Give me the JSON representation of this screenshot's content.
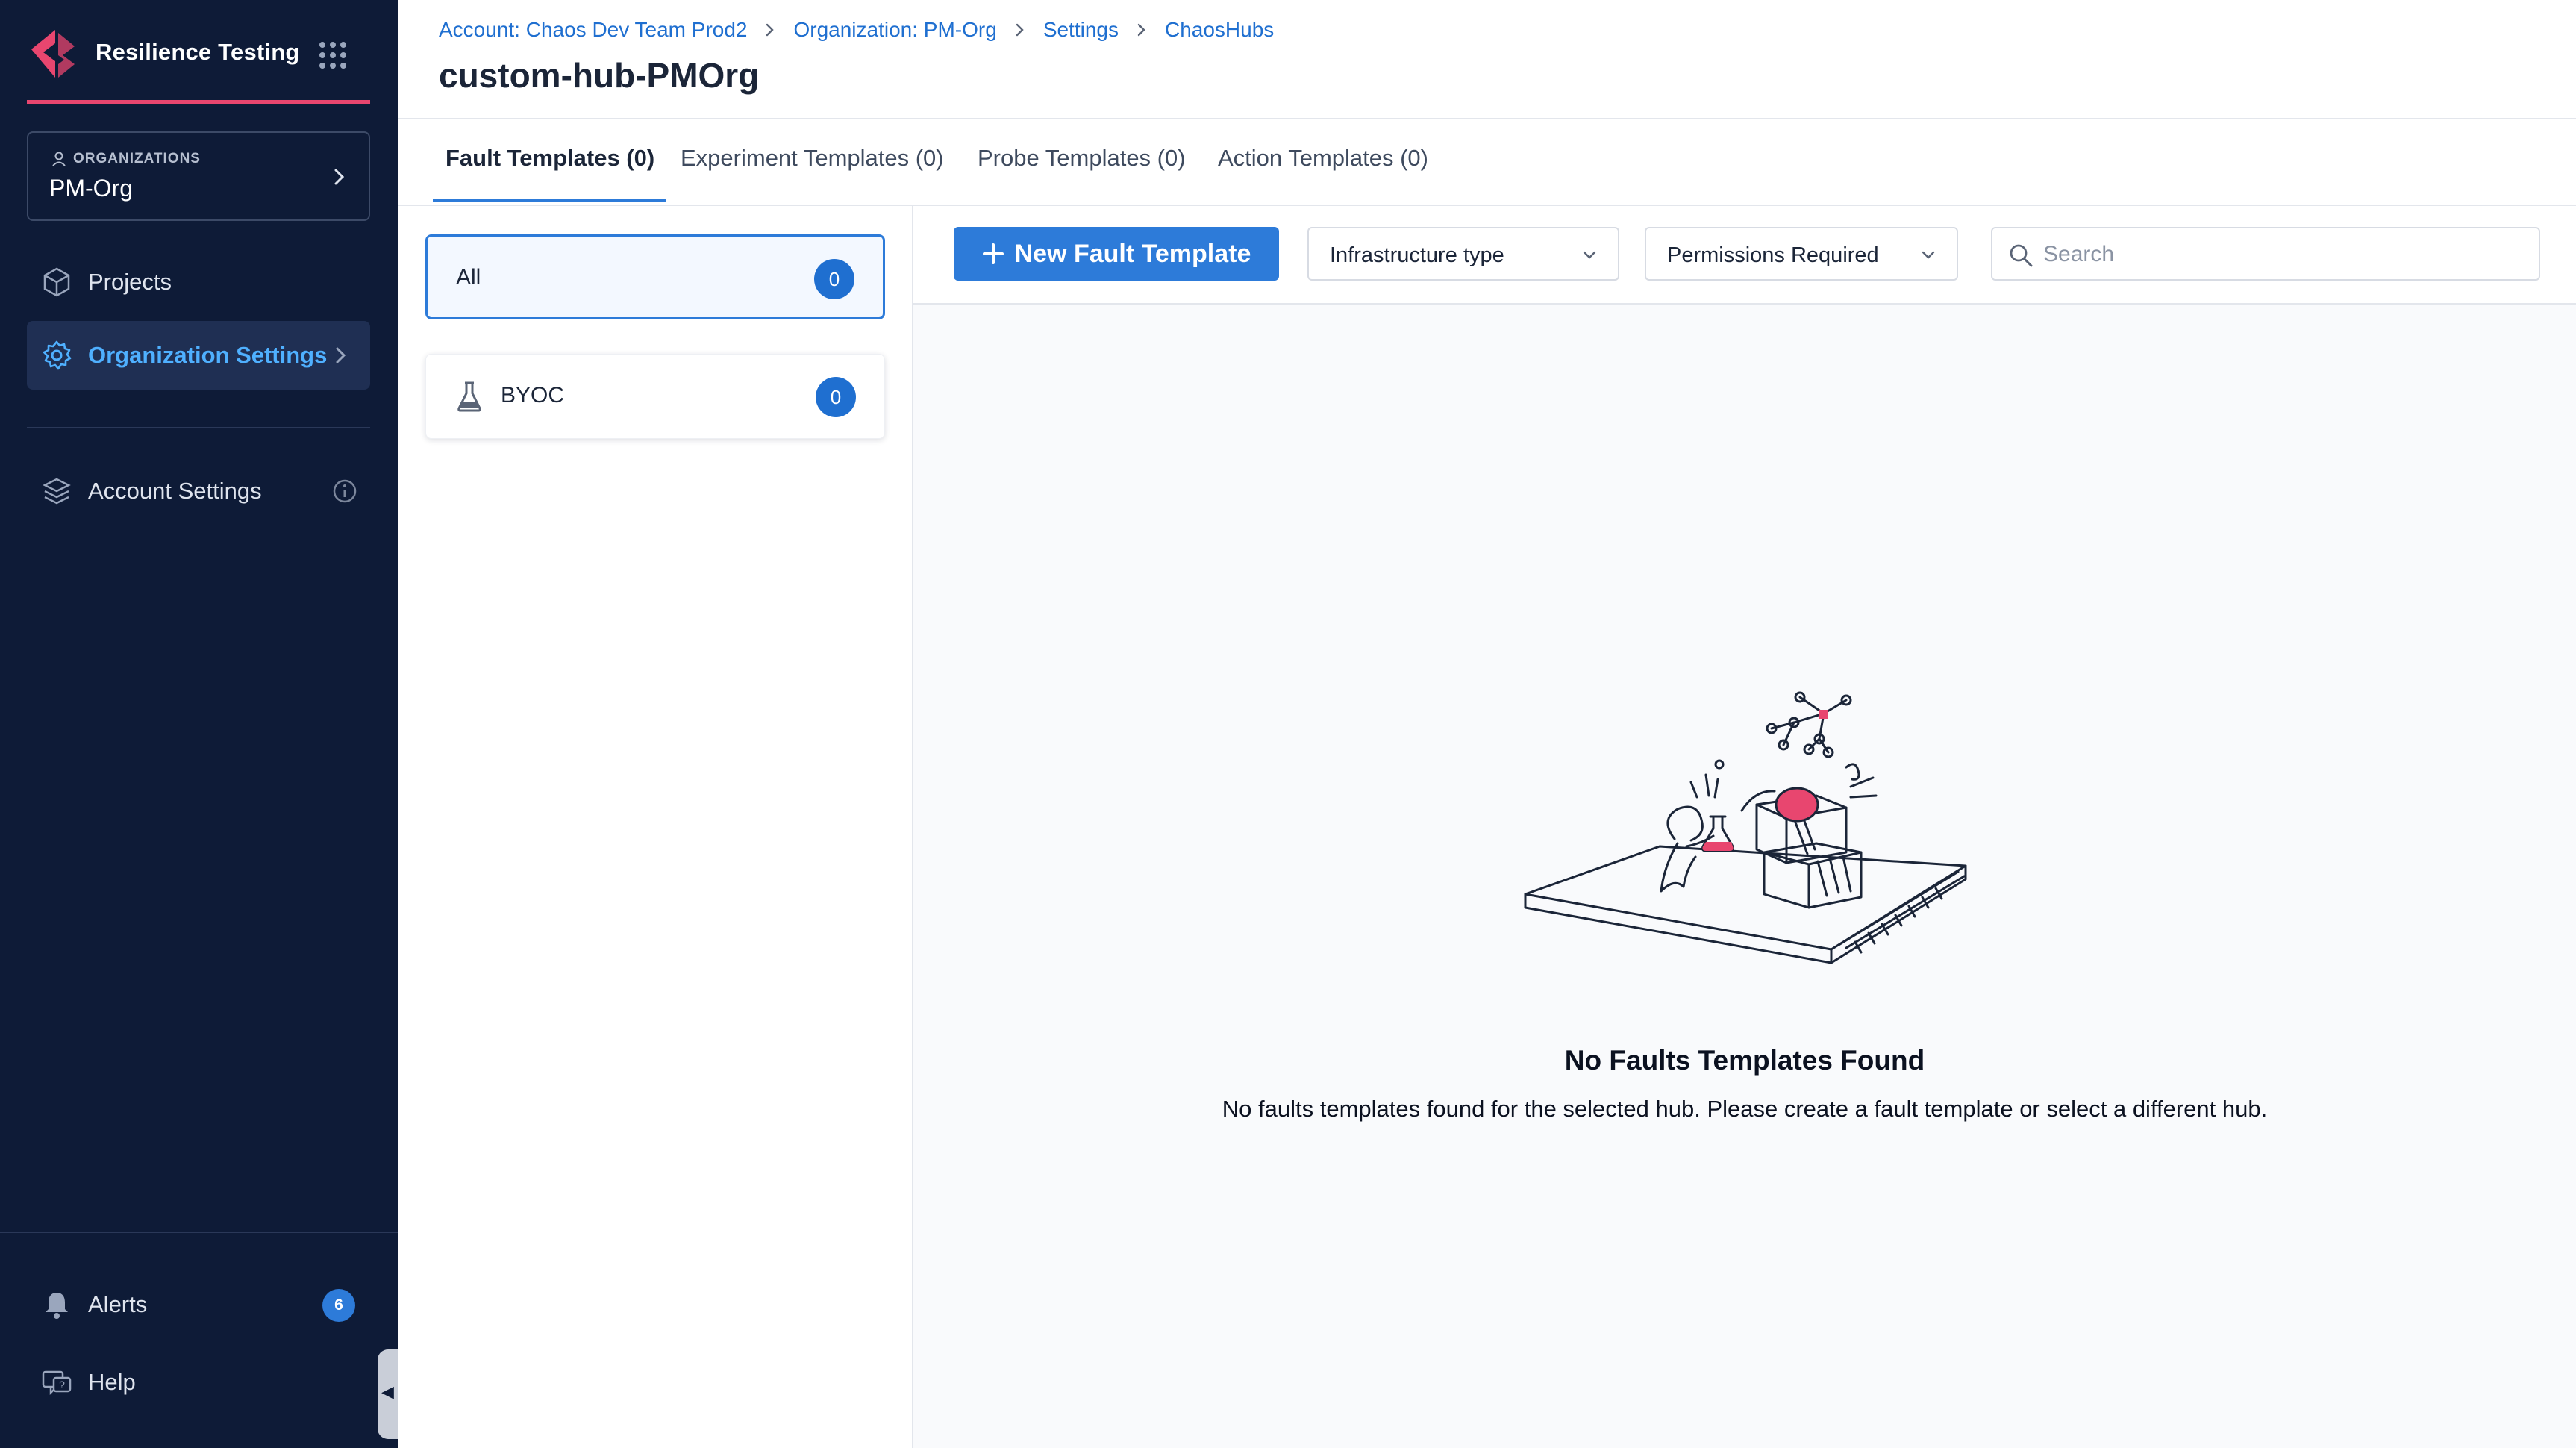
{
  "app": {
    "name": "Resilience Testing",
    "brand_color": "#e8466f"
  },
  "sidebar": {
    "org_switcher": {
      "kicker": "ORGANIZATIONS",
      "name": "PM-Org"
    },
    "nav": [
      {
        "label": "Projects",
        "icon": "projects-cube-icon"
      },
      {
        "label": "Organization Settings",
        "icon": "gear-icon",
        "active": true
      },
      {
        "label": "Account Settings",
        "icon": "account-stack-icon"
      }
    ],
    "bottom": [
      {
        "label": "Alerts",
        "icon": "bell-icon",
        "badge": "6"
      },
      {
        "label": "Help",
        "icon": "help-chat-icon"
      }
    ]
  },
  "header": {
    "breadcrumbs": [
      "Account: Chaos Dev Team Prod2",
      "Organization: PM-Org",
      "Settings",
      "ChaosHubs"
    ],
    "title": "custom-hub-PMOrg"
  },
  "tabs": [
    {
      "label": "Fault Templates (0)",
      "active": true
    },
    {
      "label": "Experiment Templates (0)"
    },
    {
      "label": "Probe Templates (0)"
    },
    {
      "label": "Action Templates (0)"
    }
  ],
  "categories": [
    {
      "label": "All",
      "count": "0",
      "selected": true
    },
    {
      "label": "BYOC",
      "count": "0",
      "icon": "flask-icon"
    }
  ],
  "toolbar": {
    "new_button": "New Fault Template",
    "filters": [
      "Infrastructure type",
      "Permissions Required"
    ],
    "search_placeholder": "Search"
  },
  "empty_state": {
    "title": "No Faults Templates Found",
    "description": "No faults templates found for the selected hub. Please create a fault template or select a different hub."
  },
  "colors": {
    "sidebar_bg": "#0e1b37",
    "accent": "#2d7bd9",
    "active_nav_text": "#4fb0ff"
  }
}
